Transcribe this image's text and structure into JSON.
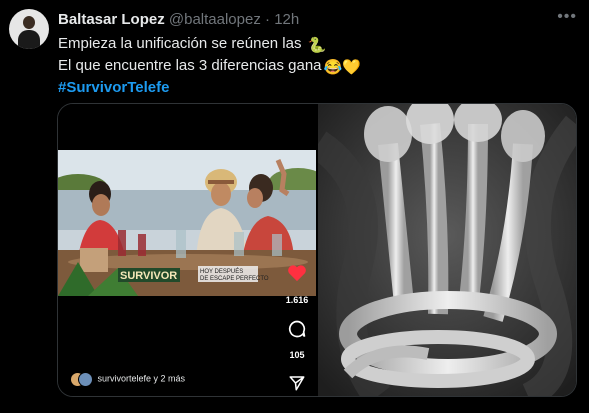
{
  "author": {
    "name": "Baltasar Lopez",
    "handle": "@baltaalopez",
    "separator": "·",
    "time": "12h"
  },
  "tweet": {
    "line1": "Empieza la unificación se reúnen las",
    "line1_emoji": "🐍",
    "line2": "El que encuentre las 3 diferencias gana",
    "line2_emoji": "😂💛",
    "hashtag": "#SurvivorTelefe"
  },
  "media_left": {
    "overlay_logo": "SURVIVOR",
    "overlay_caption_1": "HOY DESPUÉS",
    "overlay_caption_2": "DE ESCAPE PERFECTO",
    "likes": "1.616",
    "comments": "105",
    "account_text": "survivortelefe y 2 más"
  },
  "icons": {
    "more": "more-options-icon",
    "heart": "heart-icon",
    "comment": "comment-icon",
    "share": "share-icon"
  },
  "colors": {
    "background": "#000000",
    "text": "#e7e9ea",
    "muted": "#71767b",
    "hashtag": "#1d9bf0",
    "heart": "#ff3040"
  }
}
